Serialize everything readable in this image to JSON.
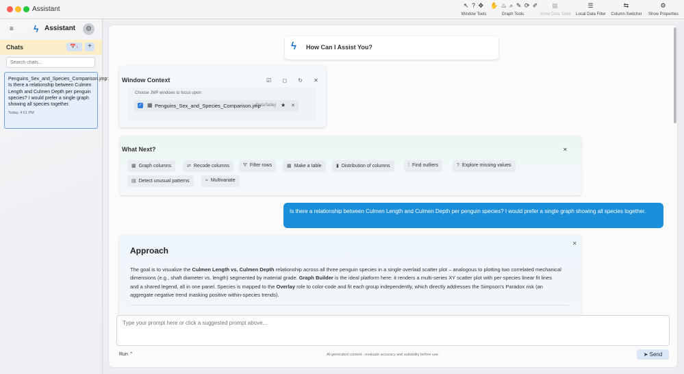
{
  "window": {
    "title": "Assistant"
  },
  "toolbar": {
    "groups": [
      {
        "label": "Window Tools",
        "icons": "↖ ? ✥",
        "disabled": false
      },
      {
        "label": "Graph Tools",
        "icons": "✋ ♨ ⌕ ✎ ⟳ ✐",
        "disabled": false
      },
      {
        "label": "Show Data Table",
        "icons": "▦",
        "disabled": true
      },
      {
        "label": "Local Data Filter",
        "icons": "☰",
        "disabled": false
      },
      {
        "label": "Column Switcher",
        "icons": "⇆",
        "disabled": false
      },
      {
        "label": "Show Properties",
        "icons": "⚙",
        "disabled": false
      }
    ]
  },
  "sidebar": {
    "menu_icon": "≡",
    "logo_icon": "ϟ",
    "brand": "Assistant",
    "settings_icon": "⚙",
    "chats_title": "Chats",
    "calendar_button": "📅↓",
    "add_button": "+",
    "search_placeholder": "Search chats...",
    "chat_items": [
      {
        "text": "Penguins_Sex_and_Species_Comparison.jmp: Is there a relationship between Culmen Length and Culmen Depth per penguin species? I would prefer a single graph showing all species together.",
        "time": "Today, 4:51 PM"
      }
    ]
  },
  "main": {
    "assist_icon": "ϟ",
    "assist_title": "How Can I Assist You?",
    "window_context": {
      "title": "Window Context",
      "header_icons": "☑ ◻ ↻ ✕",
      "subtitle": "Choose JMP windows to focus upon:",
      "row": {
        "check": "✓",
        "table_icon": "▦",
        "name": "Penguins_Sex_and_Species_Comparison.jmp",
        "kind": "(DataTable)",
        "star": "★",
        "close": "✕"
      }
    },
    "what_next": {
      "title": "What Next?",
      "close": "✕",
      "chips": [
        {
          "icon": "▦",
          "label": "Graph columns"
        },
        {
          "icon": "⇄",
          "label": "Recode columns"
        },
        {
          "icon": "⛛",
          "label": "Filter rows"
        },
        {
          "icon": "▦",
          "label": "Make a table"
        },
        {
          "icon": "▮",
          "label": "Distribution of columns"
        },
        {
          "icon": "⁞",
          "label": "Find outliers"
        },
        {
          "icon": "?",
          "label": "Explore missing values"
        },
        {
          "icon": "▤",
          "label": "Detect unusual patterns"
        },
        {
          "icon": "≈",
          "label": "Multivariate"
        }
      ]
    },
    "user_message": "Is there a relationship between Culmen Length and Culmen Depth per penguin species? I would prefer a single graph showing all species together.",
    "approach": {
      "title": "Approach",
      "close": "✕",
      "body": [
        {
          "t": "The goal is to visualize the ",
          "b": false
        },
        {
          "t": "Culmen Length vs. Culmen Depth",
          "b": true
        },
        {
          "t": " relationship across all three penguin species in a single overlaid scatter plot – analogous to plotting two correlated mechanical dimensions (e.g., shaft diameter vs. length) segmented by material grade. ",
          "b": false
        },
        {
          "t": "Graph Builder",
          "b": true
        },
        {
          "t": " is the ideal platform here: it renders a multi-series XY scatter plot with per-species linear fit lines and a shared legend, all in one panel. Species is mapped to the ",
          "b": false
        },
        {
          "t": "Overlay",
          "b": true
        },
        {
          "t": " role to color-code and fit each group independently, which directly addresses the Simpson's Paradox risk (an aggregate negative trend masking positive within-species trends).",
          "b": false
        }
      ]
    },
    "prompt_placeholder": "Type your prompt here or click a suggested prompt above...",
    "run_label": "Run ⌃",
    "disclaimer": "AI-generated content - evaluate accuracy and suitability before use.",
    "send_icon": "➤",
    "send_label": "Send"
  }
}
